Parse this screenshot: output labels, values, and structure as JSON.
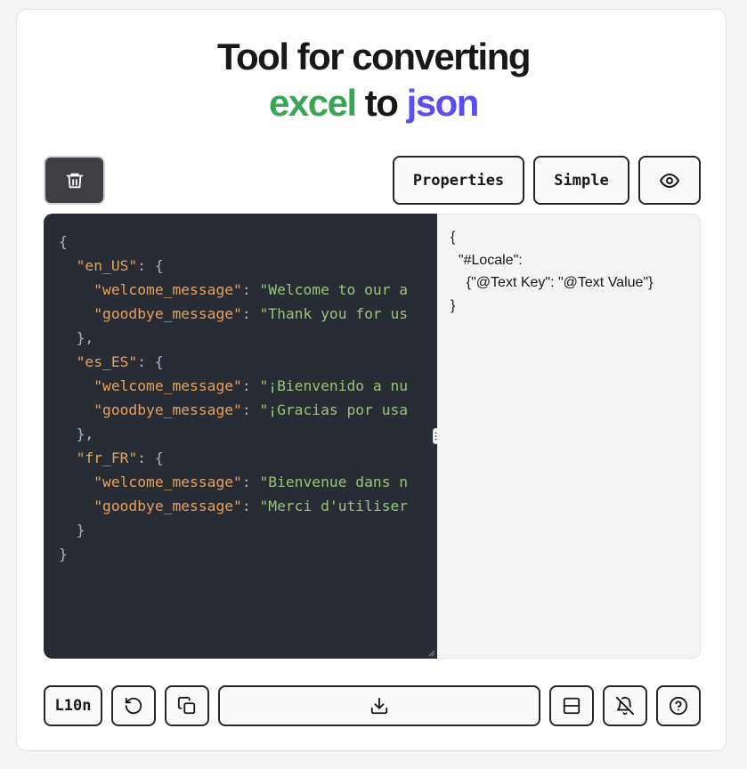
{
  "header": {
    "title_line1": "Tool for converting",
    "word_excel": "excel",
    "word_to": "to",
    "word_json": "json"
  },
  "colors": {
    "excel": "#3aa655",
    "json": "#5b4ef0",
    "editor_bg": "#282c34",
    "key": "#e5a15f",
    "string": "#98c379"
  },
  "toolbar": {
    "delete_icon": "trash-icon",
    "properties_label": "Properties",
    "simple_label": "Simple",
    "preview_icon": "eye-icon"
  },
  "editor": {
    "lines": [
      [
        {
          "t": "{",
          "c": "p"
        }
      ],
      [
        {
          "t": "  ",
          "c": "p"
        },
        {
          "t": "\"en_US\"",
          "c": "k"
        },
        {
          "t": ": {",
          "c": "p"
        }
      ],
      [
        {
          "t": "    ",
          "c": "p"
        },
        {
          "t": "\"welcome_message\"",
          "c": "k"
        },
        {
          "t": ": ",
          "c": "p"
        },
        {
          "t": "\"Welcome to our a",
          "c": "s"
        }
      ],
      [
        {
          "t": "    ",
          "c": "p"
        },
        {
          "t": "\"goodbye_message\"",
          "c": "k"
        },
        {
          "t": ": ",
          "c": "p"
        },
        {
          "t": "\"Thank you for us",
          "c": "s"
        }
      ],
      [
        {
          "t": "  },",
          "c": "p"
        }
      ],
      [
        {
          "t": "  ",
          "c": "p"
        },
        {
          "t": "\"es_ES\"",
          "c": "k"
        },
        {
          "t": ": {",
          "c": "p"
        }
      ],
      [
        {
          "t": "    ",
          "c": "p"
        },
        {
          "t": "\"welcome_message\"",
          "c": "k"
        },
        {
          "t": ": ",
          "c": "p"
        },
        {
          "t": "\"¡Bienvenido a nu",
          "c": "s"
        }
      ],
      [
        {
          "t": "    ",
          "c": "p"
        },
        {
          "t": "\"goodbye_message\"",
          "c": "k"
        },
        {
          "t": ": ",
          "c": "p"
        },
        {
          "t": "\"¡Gracias por usa",
          "c": "s"
        }
      ],
      [
        {
          "t": "  },",
          "c": "p"
        }
      ],
      [
        {
          "t": "  ",
          "c": "p"
        },
        {
          "t": "\"fr_FR\"",
          "c": "k"
        },
        {
          "t": ": {",
          "c": "p"
        }
      ],
      [
        {
          "t": "    ",
          "c": "p"
        },
        {
          "t": "\"welcome_message\"",
          "c": "k"
        },
        {
          "t": ": ",
          "c": "p"
        },
        {
          "t": "\"Bienvenue dans n",
          "c": "s"
        }
      ],
      [
        {
          "t": "    ",
          "c": "p"
        },
        {
          "t": "\"goodbye_message\"",
          "c": "k"
        },
        {
          "t": ": ",
          "c": "p"
        },
        {
          "t": "\"Merci d'utiliser",
          "c": "s"
        }
      ],
      [
        {
          "t": "  }",
          "c": "p"
        }
      ],
      [
        {
          "t": "}",
          "c": "p"
        }
      ]
    ]
  },
  "preview": {
    "text": "{\n  \"#Locale\":\n    {\"@Text Key\": \"@Text Value\"}\n}"
  },
  "bottom_bar": {
    "l10n_label": "L10n",
    "reset_icon": "rotate-ccw-icon",
    "copy_icon": "copy-icon",
    "download_icon": "download-icon",
    "layout_icon": "split-view-icon",
    "notification_icon": "bell-off-icon",
    "help_icon": "help-circle-icon"
  }
}
